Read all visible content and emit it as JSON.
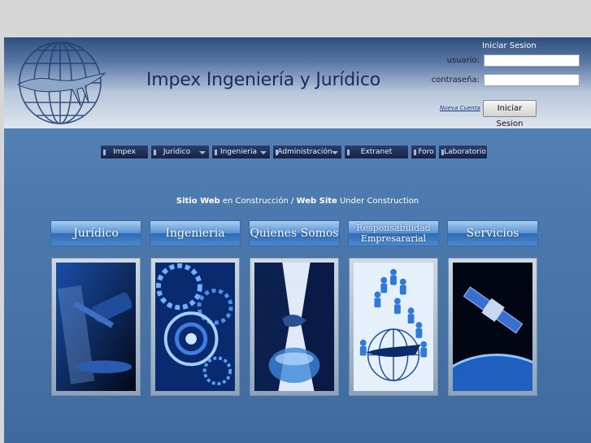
{
  "header": {
    "title": "Impex Ingeniería y Jurídico"
  },
  "login": {
    "title": "Iniciar Sesion",
    "user_label": "usuario:",
    "pass_label": "contraseña:",
    "new_account": "Nueva Cuenta",
    "submit": "Iniciar Sesion"
  },
  "nav": {
    "items": [
      {
        "label": "Impex"
      },
      {
        "label": "Juridico"
      },
      {
        "label": "Ingenieria"
      },
      {
        "label": "Administración"
      },
      {
        "label": "Extranet"
      },
      {
        "label": "Foro"
      },
      {
        "label": "Laboratorio"
      }
    ]
  },
  "notice": {
    "bold1": "Sitio Web",
    "text1": " en Construcción / ",
    "bold2": "Web Site",
    "text2": " Under Construction"
  },
  "sections": [
    {
      "label": "Jurídico"
    },
    {
      "label": "Ingenieria"
    },
    {
      "label": "Quienes Somos"
    },
    {
      "label_line1": "Responsabilidad",
      "label_line2": "Empresararial"
    },
    {
      "label": "Servicios"
    }
  ],
  "colors": {
    "nav_bg": "#142447",
    "accent": "#5b96d6",
    "title": "#1d2a5a"
  }
}
